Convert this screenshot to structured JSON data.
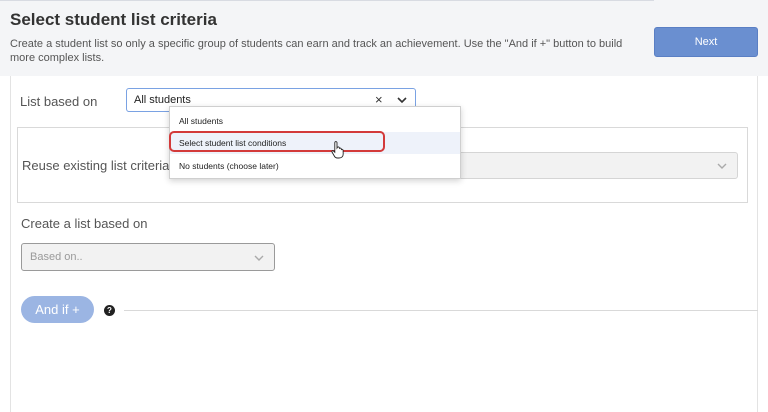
{
  "header": {
    "title": "Select student list criteria",
    "description": "Create a student list so only a specific group of students can earn and track an achievement. Use the \"And if +\" button to build more complex lists.",
    "next_label": "Next"
  },
  "list_based_on": {
    "label": "List based on",
    "value": "All students",
    "clear_icon": "×",
    "options": [
      {
        "label": "All students"
      },
      {
        "label": "Select student list conditions",
        "highlighted": true
      },
      {
        "label": "No students (choose later)"
      }
    ]
  },
  "reuse": {
    "label": "Reuse existing list criteria"
  },
  "create": {
    "label": "Create a list based on",
    "placeholder": "Based on..",
    "and_if_label": "And if +",
    "help_icon": "?"
  },
  "colors": {
    "accent": "#6a8fd0",
    "highlight_ring": "#d33a3a"
  }
}
